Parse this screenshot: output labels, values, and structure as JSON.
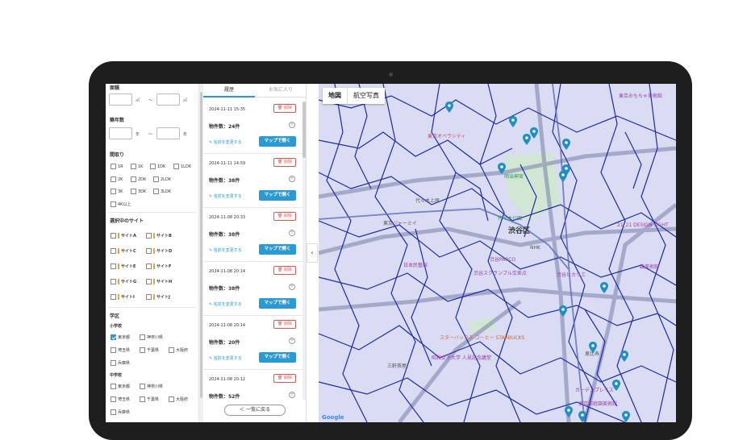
{
  "filters": {
    "area_label": "面積",
    "area_unit": "㎡",
    "range_sep": "～",
    "age_label": "築年数",
    "age_unit": "年",
    "layout_label": "間取り",
    "layouts": [
      "1R",
      "1K",
      "1DK",
      "1LDK",
      "2K",
      "2DK",
      "2LDK",
      "3K",
      "3DK",
      "3LDK",
      "4K以上"
    ],
    "sites_label": "選択中のサイト",
    "sites": [
      "サイトA",
      "サイトB",
      "サイトC",
      "サイトD",
      "サイトE",
      "サイトF",
      "サイトG",
      "サイトH",
      "サイトI",
      "サイトJ"
    ],
    "school_label": "学区",
    "elementary_label": "小学校",
    "elementary_options": [
      {
        "label": "東京都",
        "checked": true
      },
      {
        "label": "神奈川県",
        "checked": false
      },
      {
        "label": "埼玉県",
        "checked": false
      },
      {
        "label": "千葉県",
        "checked": false
      },
      {
        "label": "大阪府",
        "checked": false
      },
      {
        "label": "兵庫県",
        "checked": false
      }
    ],
    "junior_label": "中学校",
    "junior_options": [
      {
        "label": "東京都",
        "checked": false
      },
      {
        "label": "神奈川県",
        "checked": false
      },
      {
        "label": "埼玉県",
        "checked": false
      },
      {
        "label": "千葉県",
        "checked": false
      },
      {
        "label": "大阪府",
        "checked": false
      },
      {
        "label": "兵庫県",
        "checked": false
      }
    ]
  },
  "history": {
    "tab_history": "履歴",
    "tab_favorites": "お気に入り",
    "delete_label": "削除",
    "rename_label": "名前を変更する",
    "open_label": "マップで開く",
    "entries": [
      {
        "date": "2024-11-11 15:35",
        "count": "物件数：24件"
      },
      {
        "date": "2024-11-11 14:59",
        "count": "物件数：38件"
      },
      {
        "date": "2024-11-08 20:33",
        "count": "物件数：38件"
      },
      {
        "date": "2024-11-08 20:14",
        "count": "物件数：38件"
      },
      {
        "date": "2024-11-08 20:14",
        "count": "物件数：20件"
      },
      {
        "date": "2024-11-08 20:12",
        "count": "物件数：52件"
      }
    ],
    "back_label": "＜ 一覧に戻る"
  },
  "map": {
    "type_map": "地図",
    "type_satellite": "航空写真",
    "labels": {
      "shibuya": "渋谷区",
      "yoyogi_park": "代々木公園",
      "parco": "渋谷PARCO",
      "scramble": "渋谷スクランブル交差点",
      "hikarie": "渋谷ヒカリエ",
      "starbucks": "スターバックス コーヒー STARBUCKS",
      "meiji": "明治神宮",
      "tokyo_opera": "東京オペラシティ",
      "nhk": "NHK",
      "jmm": "日本民藝館",
      "tokyo_jamii": "東京ジャーミイ",
      "yoyogi_uehara": "代々木上原",
      "sangenjaya": "三軒茶屋",
      "ebisu": "恵比寿",
      "garden_place": "ガーデンプレイス",
      "toy_museum": "東京おもちゃ美術館",
      "design_sight": "21_21 DESIGN SIGHT",
      "mori": "森美術館",
      "jinja": "東京都庭園美術館",
      "women_univ": "昭和女子大学 人見記念講堂",
      "google": "Google"
    },
    "accent_color": "#2a9ad2",
    "pin_color": "#1e8fbf",
    "road_color": "#1f2aa8"
  },
  "collapse_icon": "chevron-left-icon"
}
